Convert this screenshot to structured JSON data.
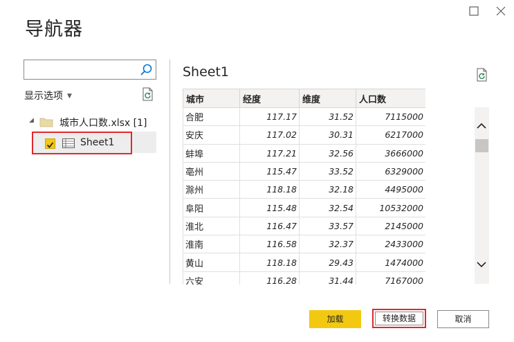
{
  "window": {
    "title": "导航器",
    "maximize_icon": "maximize-icon",
    "close_icon": "close-icon"
  },
  "left_pane": {
    "search": {
      "value": "",
      "placeholder": "",
      "icon": "search-icon"
    },
    "display_options_label": "显示选项",
    "tree": {
      "folder_label": "城市人口数.xlsx [1]",
      "sheet_label": "Sheet1",
      "sheet_checked": true
    }
  },
  "preview": {
    "title": "Sheet1",
    "columns": [
      "城市",
      "经度",
      "维度",
      "人口数"
    ],
    "rows": [
      [
        "合肥",
        "117.17",
        "31.52",
        "7115000"
      ],
      [
        "安庆",
        "117.02",
        "30.31",
        "6217000"
      ],
      [
        "蚌埠",
        "117.21",
        "32.56",
        "3666000"
      ],
      [
        "亳州",
        "115.47",
        "33.52",
        "6329000"
      ],
      [
        "滁州",
        "118.18",
        "32.18",
        "4495000"
      ],
      [
        "阜阳",
        "115.48",
        "32.54",
        "10532000"
      ],
      [
        "淮北",
        "116.47",
        "33.57",
        "2145000"
      ],
      [
        "淮南",
        "116.58",
        "32.37",
        "2433000"
      ],
      [
        "黄山",
        "118.18",
        "29.43",
        "1474000"
      ],
      [
        "六安",
        "116.28",
        "31.44",
        "7167000"
      ]
    ]
  },
  "buttons": {
    "load": "加载",
    "transform": "转换数据",
    "cancel": "取消"
  },
  "colors": {
    "accent_yellow": "#f2c811",
    "highlight_red": "#e0282e"
  }
}
